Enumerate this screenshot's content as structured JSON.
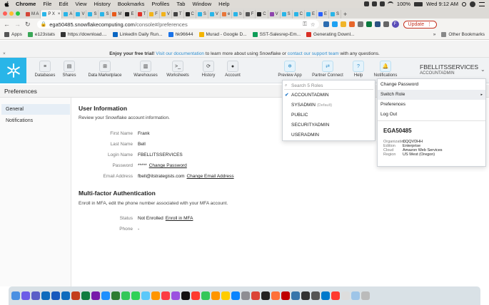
{
  "macos_menu": {
    "app": "Chrome",
    "items": [
      "File",
      "Edit",
      "View",
      "History",
      "Bookmarks",
      "Profiles",
      "Tab",
      "Window",
      "Help"
    ],
    "battery": "100%",
    "clock": "Wed 9:12 AM"
  },
  "browser": {
    "tabs": [
      {
        "label": "M A",
        "color": "#d44638"
      },
      {
        "label": "P X",
        "color": "#29b5e8",
        "active": true
      },
      {
        "label": "A",
        "color": "#29b5e8"
      },
      {
        "label": "V",
        "color": "#29b5e8"
      },
      {
        "label": "S",
        "color": "#29b5e8"
      },
      {
        "label": "S",
        "color": "#29b5e8"
      },
      {
        "label": "M",
        "color": "#e85a1a"
      },
      {
        "label": "E",
        "color": "#222222"
      },
      {
        "label": "T",
        "color": "#e0342b"
      },
      {
        "label": "F",
        "color": "#f2b31a"
      },
      {
        "label": "V",
        "color": "#f2b31a"
      },
      {
        "label": "T",
        "color": "#444444"
      },
      {
        "label": "C",
        "color": "#222222"
      },
      {
        "label": "S",
        "color": "#29b5e8"
      },
      {
        "label": "V",
        "color": "#29b5e8"
      },
      {
        "label": "e",
        "color": "#e8763a"
      },
      {
        "label": "b",
        "color": "#29b5e8"
      },
      {
        "label": "F",
        "color": "#555555"
      },
      {
        "label": "C",
        "color": "#222222"
      },
      {
        "label": "V",
        "color": "#8e44ad"
      },
      {
        "label": "S",
        "color": "#29b5e8"
      },
      {
        "label": "C",
        "color": "#29b5e8"
      },
      {
        "label": "E",
        "color": "#29b5e8"
      },
      {
        "label": "E",
        "color": "#2962ff"
      },
      {
        "label": "S",
        "color": "#29b5e8"
      }
    ],
    "url_host": "ega50485.snowflakecomputing.com",
    "url_path": "/console#/preferences",
    "update_label": "Update",
    "profile_initial": "F"
  },
  "bookmarks": {
    "items": [
      {
        "label": "Apps",
        "color": "#555555"
      },
      {
        "label": "e123stats",
        "color": "#3aa757"
      },
      {
        "label": "https://download....",
        "color": "#333333"
      },
      {
        "label": "LinkedIn Daily Run...",
        "color": "#0a66c2"
      },
      {
        "label": "hk96644",
        "color": "#1a73e8"
      },
      {
        "label": "Murad - Google D...",
        "color": "#f4b400"
      },
      {
        "label": "SST-Salesrep-Em...",
        "color": "#0f9d58"
      },
      {
        "label": "Generating Downl...",
        "color": "#d93025"
      }
    ],
    "more": "»",
    "other": "Other Bookmarks"
  },
  "trial_banner": {
    "lead": "Enjoy your free trial!",
    "link1": "Visit our documentation",
    "mid": "to learn more about using Snowflake or",
    "link2": "contact our support team",
    "tail": "with any questions.",
    "close": "×"
  },
  "nav": {
    "items": [
      {
        "label": "Databases",
        "icon": "database-icon"
      },
      {
        "label": "Shares",
        "icon": "shares-icon"
      },
      {
        "label": "Data Marketplace",
        "icon": "marketplace-icon"
      },
      {
        "label": "Warehouses",
        "icon": "warehouse-icon"
      },
      {
        "label": "Worksheets",
        "icon": "terminal-icon"
      },
      {
        "label": "History",
        "icon": "history-icon"
      },
      {
        "label": "Account",
        "icon": "account-icon"
      }
    ],
    "right_items": [
      {
        "label": "Preview App",
        "icon": "snowflake-icon"
      },
      {
        "label": "Partner Connect",
        "icon": "partner-connect-icon"
      },
      {
        "label": "Help",
        "icon": "help-icon"
      },
      {
        "label": "Notifications",
        "icon": "bell-icon"
      }
    ],
    "account_name": "FBELLITSSERVICES",
    "account_role": "ACCOUNTADMIN"
  },
  "page_title": "Preferences",
  "sidebar": {
    "items": [
      "General",
      "Notifications"
    ]
  },
  "user_info": {
    "heading": "User Information",
    "description": "Review your Snowflake account information.",
    "fields": [
      {
        "label": "First Name",
        "value": "Frank",
        "link": ""
      },
      {
        "label": "Last Name",
        "value": "Bell",
        "link": ""
      },
      {
        "label": "Login Name",
        "value": "FBELLITSSERVICES",
        "link": ""
      },
      {
        "label": "Password",
        "value": "*****",
        "link": "Change Password"
      },
      {
        "label": "Email Address",
        "value": "fbell@itstrategists.com",
        "link": "Change Email Address"
      }
    ]
  },
  "mfa": {
    "heading": "Multi-factor Authentication",
    "description": "Enroll in MFA, edit the phone number associated with your MFA account.",
    "fields": [
      {
        "label": "Status",
        "value": "Not Enrolled",
        "link": "Enroll in MFA"
      },
      {
        "label": "Phone",
        "value": "-",
        "link": ""
      }
    ]
  },
  "roles_dropdown": {
    "search_placeholder": "Search 5 Roles",
    "roles": [
      {
        "name": "ACCOUNTADMIN",
        "note": "",
        "checked": true
      },
      {
        "name": "SYSADMIN",
        "note": "(Default)",
        "checked": false
      },
      {
        "name": "PUBLIC",
        "note": "",
        "checked": false
      },
      {
        "name": "SECURITYADMIN",
        "note": "",
        "checked": false
      },
      {
        "name": "USERADMIN",
        "note": "",
        "checked": false
      }
    ]
  },
  "account_menu": {
    "items": [
      "Change Password",
      "Switch Role",
      "Preferences",
      "Log Out"
    ],
    "account_id": "EGA50485",
    "details": [
      {
        "key": "Organization",
        "value": "CQQVDHH"
      },
      {
        "key": "Edition",
        "value": "Enterprise"
      },
      {
        "key": "Cloud",
        "value": "Amazon Web Services"
      },
      {
        "key": "Region",
        "value": "US West (Oregon)"
      }
    ]
  },
  "dock": {
    "apps": [
      {
        "icon": "finder-icon",
        "color": "#4a90e2"
      },
      {
        "icon": "launchpad-icon",
        "color": "#6c5ce7"
      },
      {
        "icon": "teams-icon",
        "color": "#5b5fc7"
      },
      {
        "icon": "outlook-icon",
        "color": "#0f6cbd"
      },
      {
        "icon": "word-icon",
        "color": "#185abd"
      },
      {
        "icon": "outlook2-icon",
        "color": "#0f6cbd"
      },
      {
        "icon": "powerpoint-icon",
        "color": "#c43e1c"
      },
      {
        "icon": "excel-icon",
        "color": "#107c41"
      },
      {
        "icon": "onenote-icon",
        "color": "#7719aa"
      },
      {
        "icon": "safari-icon",
        "color": "#1e90ff"
      },
      {
        "icon": "vpn-icon",
        "color": "#2e7d32"
      },
      {
        "icon": "facetime-icon",
        "color": "#34c759"
      },
      {
        "icon": "messages-icon",
        "color": "#30d158"
      },
      {
        "icon": "maps-icon",
        "color": "#5ac8fa"
      },
      {
        "icon": "photos-icon",
        "color": "#ff9500"
      },
      {
        "icon": "music-icon",
        "color": "#fc3c44"
      },
      {
        "icon": "podcasts-icon",
        "color": "#9b51e0"
      },
      {
        "icon": "appletv-icon",
        "color": "#111111"
      },
      {
        "icon": "news-icon",
        "color": "#ff3b30"
      },
      {
        "icon": "numbers-icon",
        "color": "#34c759"
      },
      {
        "icon": "pages-icon",
        "color": "#ff9500"
      },
      {
        "icon": "notes-icon",
        "color": "#ffcc00"
      },
      {
        "icon": "appstore-icon",
        "color": "#0a84ff"
      },
      {
        "icon": "settings-icon",
        "color": "#8e8e93"
      },
      {
        "icon": "chrome-icon",
        "color": "#db4437"
      },
      {
        "icon": "terminal-icon",
        "color": "#222222"
      },
      {
        "icon": "firefox-icon",
        "color": "#ff7139"
      },
      {
        "icon": "filezilla-icon",
        "color": "#bf0000"
      },
      {
        "icon": "python-icon",
        "color": "#3776ab"
      },
      {
        "icon": "terminal2-icon",
        "color": "#333333"
      },
      {
        "icon": "console-icon",
        "color": "#555555"
      },
      {
        "icon": "vscode-icon",
        "color": "#007acc"
      },
      {
        "icon": "calendar-icon",
        "color": "#ff3b30"
      },
      {
        "icon": "preview-icon",
        "color": "#dddddd"
      },
      {
        "icon": "downloads-icon",
        "color": "#9ec5e8"
      },
      {
        "icon": "trash-icon",
        "color": "#bbbbbb"
      }
    ]
  }
}
